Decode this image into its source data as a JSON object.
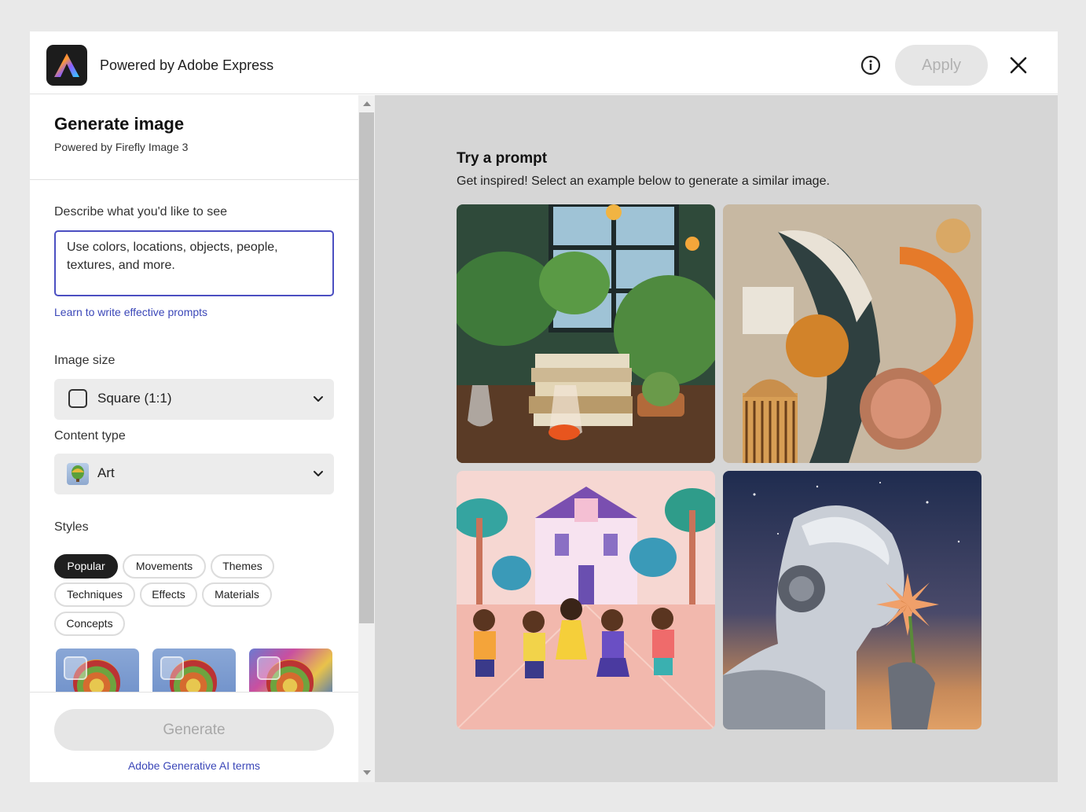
{
  "header": {
    "brand_title": "Powered by Adobe Express",
    "apply_label": "Apply",
    "info_icon": "info-icon",
    "close_icon": "close-icon"
  },
  "panel": {
    "title": "Generate image",
    "subtitle": "Powered by Firefly Image 3",
    "prompt_label": "Describe what you'd like to see",
    "prompt_value": "",
    "prompt_placeholder": "Use colors, locations, objects, people, textures, and more.",
    "learn_link": "Learn to write effective prompts",
    "image_size_label": "Image size",
    "image_size_value": "Square (1:1)",
    "content_type_label": "Content type",
    "content_type_value": "Art",
    "styles_label": "Styles",
    "style_chips": [
      "Popular",
      "Movements",
      "Themes",
      "Techniques",
      "Effects",
      "Materials",
      "Concepts"
    ],
    "active_chip": "Popular",
    "generate_label": "Generate",
    "terms_link": "Adobe Generative AI terms"
  },
  "inspiration": {
    "title": "Try a prompt",
    "subtitle": "Get inspired! Select an example below to generate a similar image.",
    "tiles": [
      "Plants and books study interior",
      "Abstract geometric shapes composition",
      "Children walking toward colorful palace",
      "Robot smelling a flower"
    ]
  },
  "colors": {
    "accent": "#4b4fc1",
    "link": "#3b47b8",
    "disabled_bg": "#e6e6e6",
    "active_chip": "#1f1f1f"
  }
}
